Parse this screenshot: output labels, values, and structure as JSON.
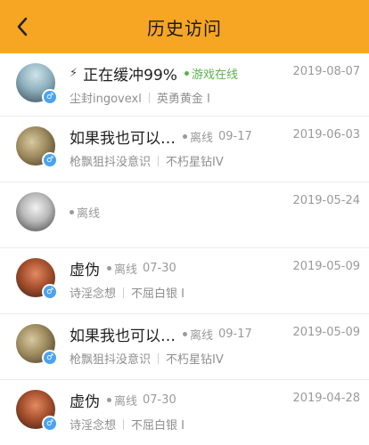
{
  "header": {
    "title": "历史访问",
    "back_icon": "chevron-left-icon",
    "bg": "#f6a623"
  },
  "rows": [
    {
      "name": "正在缓冲99%",
      "prefix": "⚡",
      "status": "游戏在线",
      "status_time": "",
      "date": "2019-08-07",
      "sub1": "尘封ingovexl",
      "sub2": "英勇黄金 I",
      "online": true
    },
    {
      "name": "如果我也可以…",
      "status": "离线",
      "status_time": "09-17",
      "date": "2019-06-03",
      "sub1": "枪飘狙抖没意识",
      "sub2": "不朽星钻IV"
    },
    {
      "name": "",
      "status": "离线",
      "status_time": "",
      "date": "2019-05-24",
      "sub1": "",
      "sub2": ""
    },
    {
      "name": "虚伪",
      "status": "离线",
      "status_time": "07-30",
      "date": "2019-05-09",
      "sub1": "诗淫念想",
      "sub2": "不屈白银 I"
    },
    {
      "name": "如果我也可以…",
      "status": "离线",
      "status_time": "09-17",
      "date": "2019-05-09",
      "sub1": "枪飘狙抖没意识",
      "sub2": "不朽星钻IV"
    },
    {
      "name": "虚伪",
      "status": "离线",
      "status_time": "07-30",
      "date": "2019-04-28",
      "sub1": "诗淫念想",
      "sub2": "不屈白银 I"
    }
  ],
  "gender_icon": "male-icon"
}
